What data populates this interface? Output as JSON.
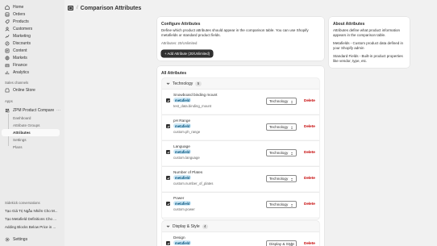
{
  "sidebar": {
    "main_items": [
      {
        "label": "Home",
        "icon": "home-icon"
      },
      {
        "label": "Orders",
        "icon": "orders-icon"
      },
      {
        "label": "Products",
        "icon": "products-icon"
      },
      {
        "label": "Customers",
        "icon": "customers-icon"
      },
      {
        "label": "Marketing",
        "icon": "marketing-icon"
      },
      {
        "label": "Discounts",
        "icon": "discounts-icon"
      },
      {
        "label": "Content",
        "icon": "content-icon"
      },
      {
        "label": "Markets",
        "icon": "markets-icon"
      },
      {
        "label": "Finance",
        "icon": "finance-icon"
      },
      {
        "label": "Analytics",
        "icon": "analytics-icon"
      }
    ],
    "sales_channels_label": "Sales channels",
    "online_store": "Online Store",
    "apps_label": "Apps",
    "app_name": "ZPM Product Compare",
    "app_sub_items": [
      "Dashboard",
      "Attribute Groups",
      "Attributes",
      "Settings",
      "Plans"
    ],
    "sidekick_label": "Sidekick conversations",
    "conversations": [
      "Tạo Giá Trị Ngẫu Nhiên Cho M...",
      "Tạo Metafield Definitions Cho ...",
      "Adding Blocks Below Price in ..."
    ],
    "settings": "Settings"
  },
  "header": {
    "breadcrumb_sep": "/",
    "title": "Comparison Attributes"
  },
  "configure": {
    "title": "Configure Attributes",
    "description": "Define which product attributes should appear in the comparison table. You can use Shopify metafields or standard product fields.",
    "attributes_count": "Attributes: 20/Unlimited",
    "add_button": "+ Add Attribute (20/Unlimited)"
  },
  "about": {
    "title": "About Attributes",
    "p1": "Attributes define what product information appears in the comparison table.",
    "p2": "Metafields - Custom product data defined in your Shopify admin",
    "p3": "Standard Fields - Built-in product properties like vendor, type, etc."
  },
  "all_attributes": {
    "title": "All Attributes",
    "groups": [
      {
        "name": "Technology",
        "count": "5"
      },
      {
        "name": "Display & Style",
        "count": "4"
      }
    ],
    "rows": [
      {
        "name": "Snowboard binding mount",
        "badge": "metafield",
        "key": "test_data.binding_mount",
        "group": "Technology",
        "delete": "Delete"
      },
      {
        "name": "pH Range",
        "badge": "metafield",
        "key": "custom.ph_range",
        "group": "Technology",
        "delete": "Delete"
      },
      {
        "name": "Language",
        "badge": "metafield",
        "key": "custom.language",
        "group": "Technology",
        "delete": "Delete"
      },
      {
        "name": "Number of Plates",
        "badge": "metafield",
        "key": "custom.number_of_plates",
        "group": "Technology",
        "delete": "Delete"
      },
      {
        "name": "Power",
        "badge": "metafield",
        "key": "custom.power",
        "group": "Technology",
        "delete": "Delete"
      },
      {
        "name": "Design",
        "badge": "metafield",
        "key": "",
        "group": "Display & Style",
        "delete": "Delete"
      }
    ]
  },
  "colors": {
    "primary": "#303030",
    "critical": "#c40000",
    "badge_bg": "#cfe9f7",
    "badge_text": "#00527c",
    "sidebar_bg": "#ebebeb",
    "page_bg": "#f1f1f1"
  }
}
